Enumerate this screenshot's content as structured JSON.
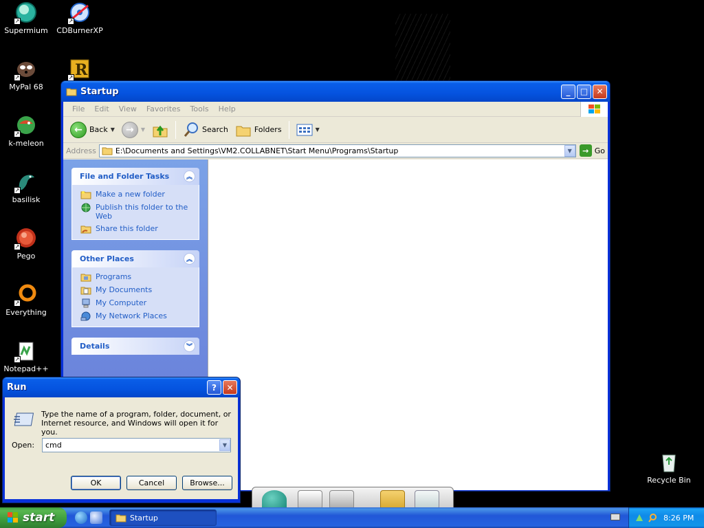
{
  "desktop": {
    "icons": [
      {
        "label": "Supermium",
        "icon": "supermium-icon"
      },
      {
        "label": "CDBurnerXP",
        "icon": "cdburnerxp-icon"
      },
      {
        "label": "MyPal 68",
        "icon": "mypal-icon"
      },
      {
        "label": "",
        "icon": "r-app-icon"
      },
      {
        "label": "k-meleon",
        "icon": "k-meleon-icon"
      },
      {
        "label": "basilisk",
        "icon": "basilisk-icon"
      },
      {
        "label": "Pego",
        "icon": "pego-icon"
      },
      {
        "label": "Everything",
        "icon": "everything-icon"
      },
      {
        "label": "Notepad++",
        "icon": "notepadpp-icon"
      },
      {
        "label": "Recycle Bin",
        "icon": "recycle-bin-icon"
      }
    ]
  },
  "explorer": {
    "title": "Startup",
    "menu": [
      "File",
      "Edit",
      "View",
      "Favorites",
      "Tools",
      "Help"
    ],
    "toolbar": {
      "back": "Back",
      "search": "Search",
      "folders": "Folders"
    },
    "address": {
      "label": "Address",
      "value": "E:\\Documents and Settings\\VM2.COLLABNET\\Start Menu\\Programs\\Startup",
      "go": "Go"
    },
    "tasks": {
      "file_folder": {
        "title": "File and Folder Tasks",
        "links": [
          "Make a new folder",
          "Publish this folder to the Web",
          "Share this folder"
        ]
      },
      "other_places": {
        "title": "Other Places",
        "links": [
          "Programs",
          "My Documents",
          "My Computer",
          "My Network Places"
        ]
      },
      "details": {
        "title": "Details"
      }
    }
  },
  "run_dialog": {
    "title": "Run",
    "description": "Type the name of a program, folder, document, or Internet resource, and Windows will open it for you.",
    "open_label": "Open:",
    "open_value": "cmd",
    "ok": "OK",
    "cancel": "Cancel",
    "browse": "Browse..."
  },
  "taskbar": {
    "start": "start",
    "task": "Startup",
    "clock": "8:26 PM"
  },
  "colors": {
    "xp_blue": "#0831d9",
    "taskpane_link": "#215dc6",
    "start_green": "#3d9c3d"
  }
}
